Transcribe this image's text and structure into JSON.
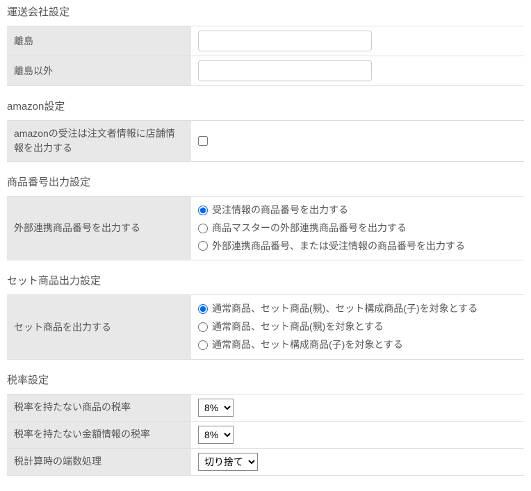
{
  "carrier": {
    "title": "運送会社設定",
    "rows": {
      "island_label": "離島",
      "island_value": "",
      "nonisland_label": "離島以外",
      "nonisland_value": ""
    }
  },
  "amazon": {
    "title": "amazon設定",
    "row_label": "amazonの受注は注文者情報に店舗情報を出力する",
    "checked": false
  },
  "product_no": {
    "title": "商品番号出力設定",
    "row_label": "外部連携商品番号を出力する",
    "options": [
      "受注情報の商品番号を出力する",
      "商品マスターの外部連携商品番号を出力する",
      "外部連携商品番号、または受注情報の商品番号を出力する"
    ],
    "selected": 0
  },
  "set_product": {
    "title": "セット商品出力設定",
    "row_label": "セット商品を出力する",
    "options": [
      "通常商品、セット商品(親)、セット構成商品(子)を対象とする",
      "通常商品、セット商品(親)を対象とする",
      "通常商品、セット構成商品(子)を対象とする"
    ],
    "selected": 0
  },
  "tax": {
    "title": "税率設定",
    "rows": {
      "no_item_rate_label": "税率を持たない商品の税率",
      "no_item_rate_value": "8%",
      "no_amount_rate_label": "税率を持たない金額情報の税率",
      "no_amount_rate_value": "8%",
      "rounding_label": "税計算時の端数処理",
      "rounding_value": "切り捨て"
    }
  }
}
